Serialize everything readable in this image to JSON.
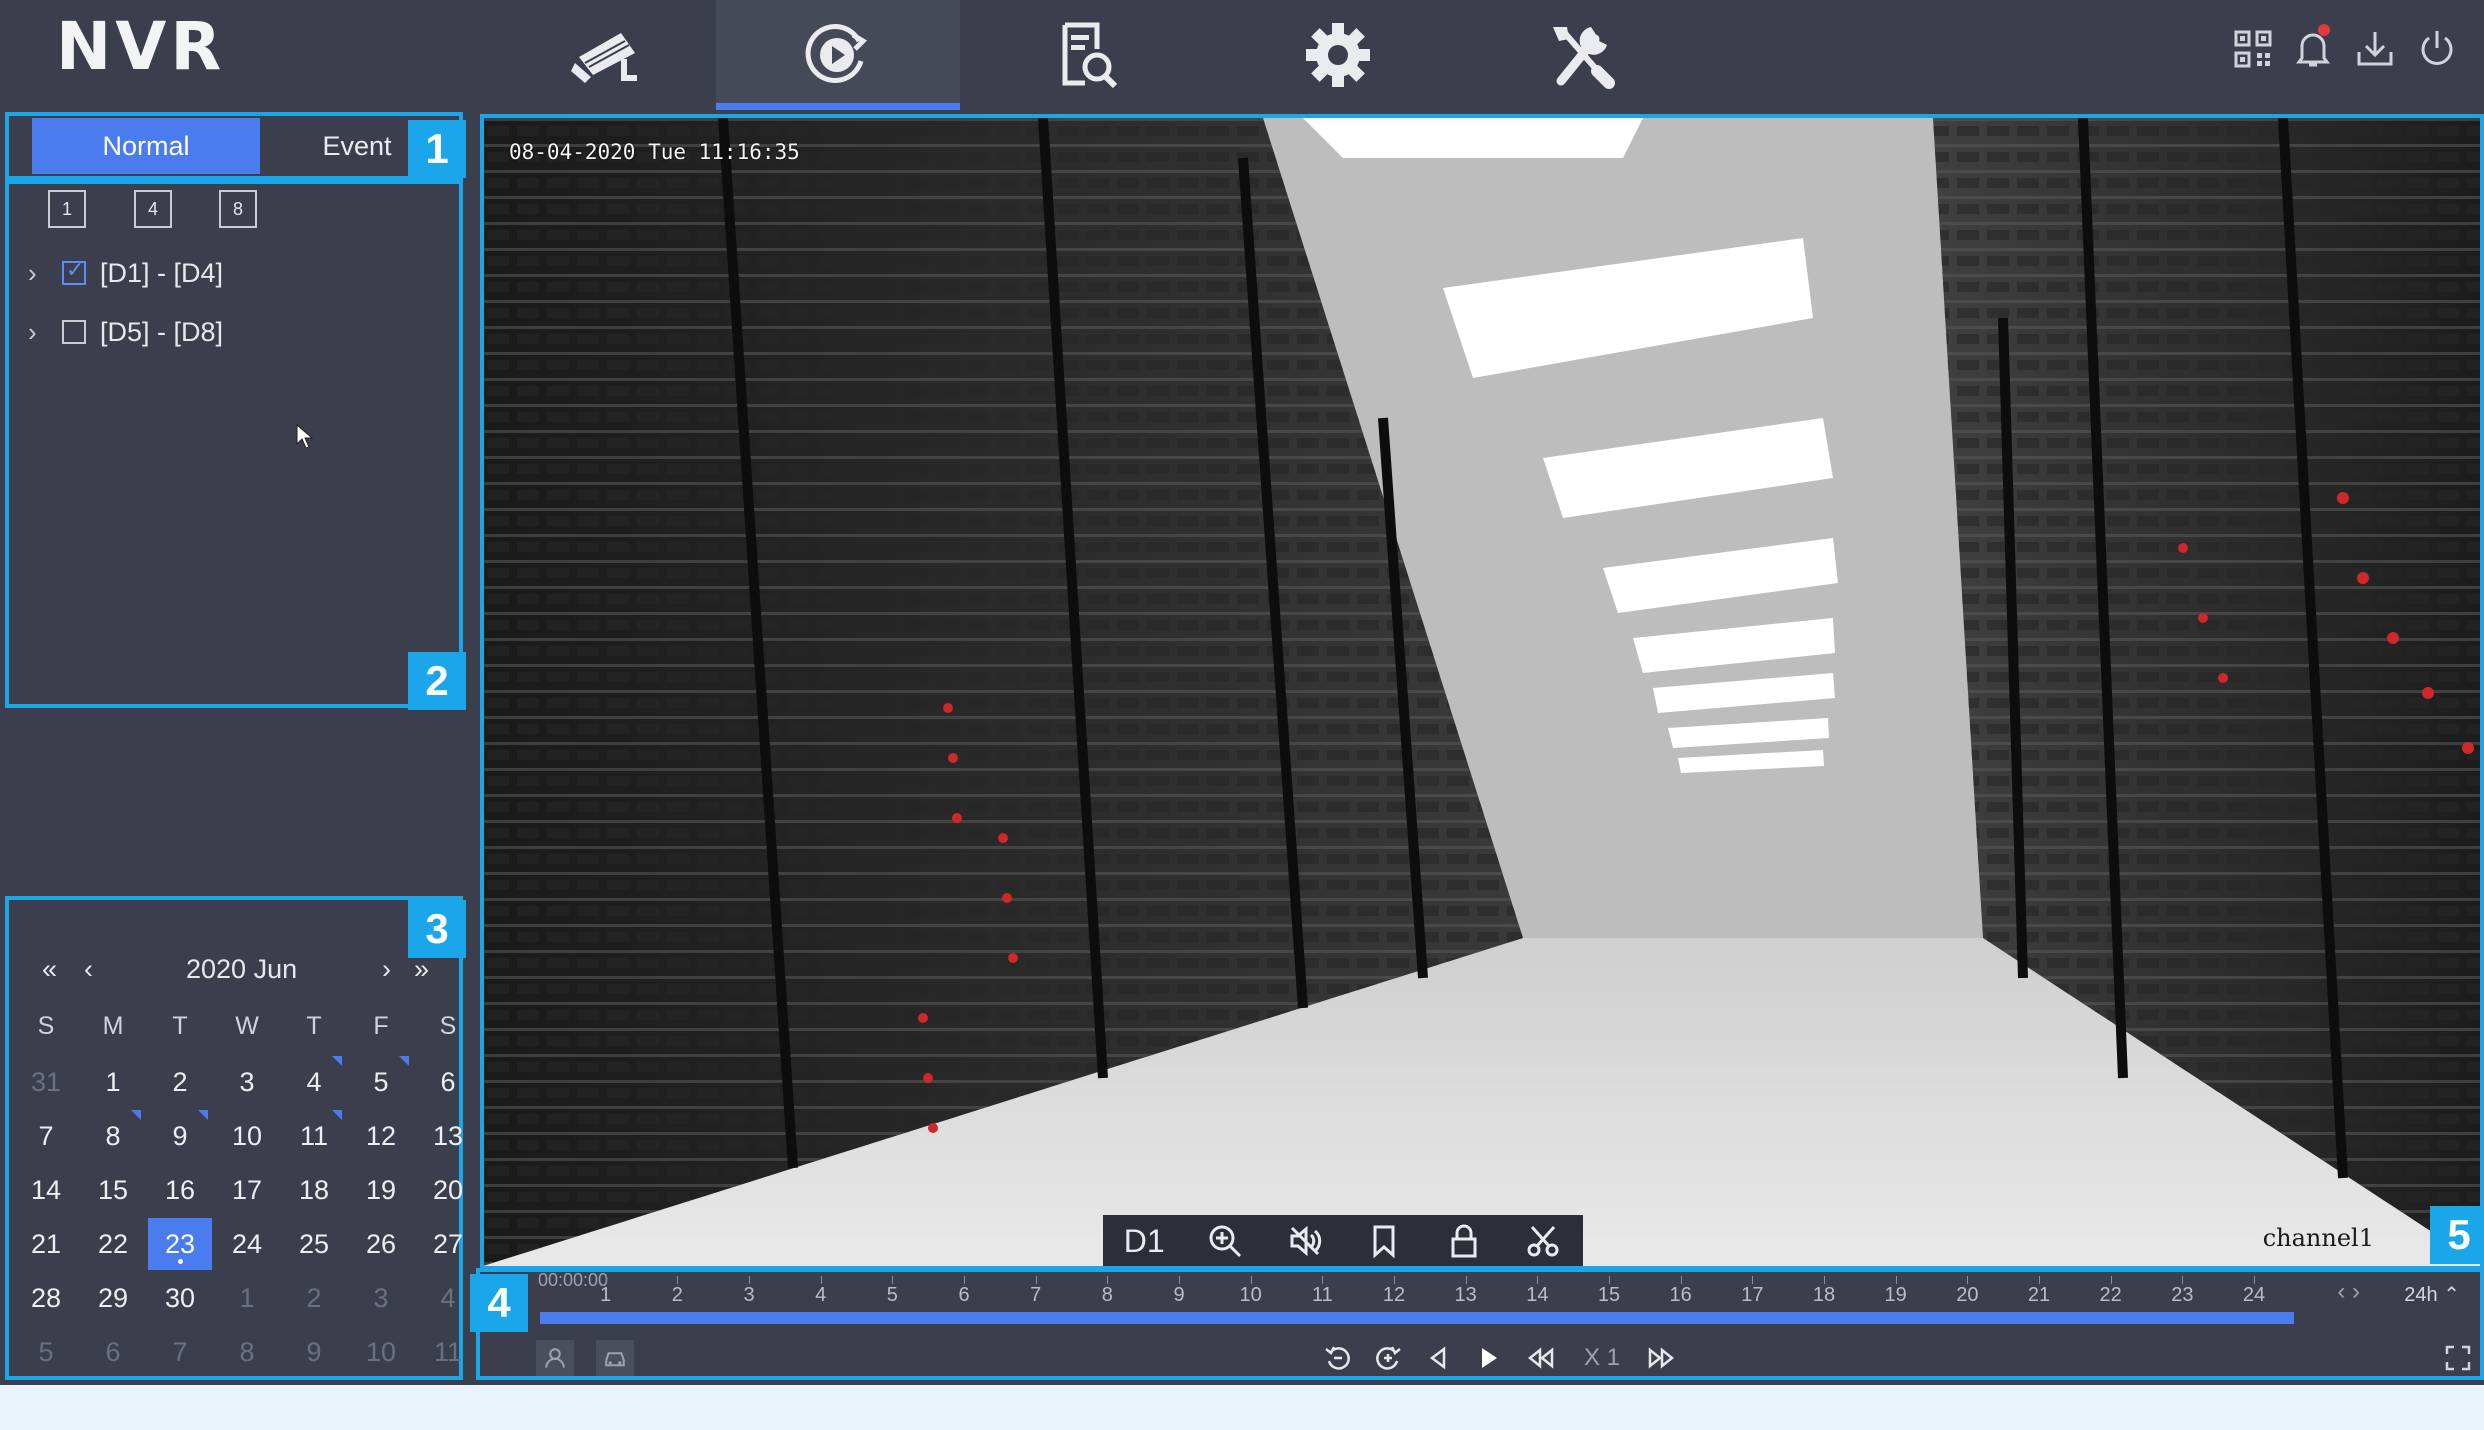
{
  "app": {
    "logo": "NVR"
  },
  "nav": {
    "items": [
      {
        "name": "live-view",
        "icon": "camera-icon"
      },
      {
        "name": "playback",
        "icon": "playback-icon",
        "active": true
      },
      {
        "name": "search",
        "icon": "file-search-icon"
      },
      {
        "name": "configuration",
        "icon": "gear-icon"
      },
      {
        "name": "maintenance",
        "icon": "tools-icon"
      }
    ],
    "right_icons": [
      "qr-code-icon",
      "bell-icon",
      "download-icon",
      "power-icon"
    ]
  },
  "left": {
    "tabs": [
      "Normal",
      "Event"
    ],
    "layouts": [
      "1",
      "4",
      "8"
    ],
    "tree": [
      {
        "label": "[D1] - [D4]",
        "checked": true
      },
      {
        "label": "[D5] - [D8]",
        "checked": false
      }
    ]
  },
  "badges": {
    "b1": "1",
    "b2": "2",
    "b3": "3",
    "b4": "4",
    "b5": "5"
  },
  "calendar": {
    "title": "2020 Jun",
    "first_prev": "«",
    "prev": "‹",
    "next": "›",
    "last_next": "»",
    "dow": [
      "S",
      "M",
      "T",
      "W",
      "T",
      "F",
      "S"
    ],
    "weeks": [
      [
        "31",
        "1",
        "2",
        "3",
        "4",
        "5",
        "6"
      ],
      [
        "7",
        "8",
        "9",
        "10",
        "11",
        "12",
        "13"
      ],
      [
        "14",
        "15",
        "16",
        "17",
        "18",
        "19",
        "20"
      ],
      [
        "21",
        "22",
        "23",
        "24",
        "25",
        "26",
        "27"
      ],
      [
        "28",
        "29",
        "30",
        "1",
        "2",
        "3",
        "4"
      ],
      [
        "5",
        "6",
        "7",
        "8",
        "9",
        "10",
        "11"
      ]
    ],
    "selected": "23",
    "recorded_days": [
      "4",
      "5",
      "8",
      "9",
      "11"
    ]
  },
  "video": {
    "osd_time": "08-04-2020 Tue 11:16:35",
    "channel_label": "channel1",
    "toolbar": {
      "channel": "D1"
    }
  },
  "timeline": {
    "start_label": "00:00:00",
    "hours": [
      "1",
      "2",
      "3",
      "4",
      "5",
      "6",
      "7",
      "8",
      "9",
      "10",
      "11",
      "12",
      "13",
      "14",
      "15",
      "16",
      "17",
      "18",
      "19",
      "20",
      "21",
      "22",
      "23",
      "24"
    ],
    "zoom": "24h",
    "speed": "X 1"
  },
  "colors": {
    "accent": "#4a7cf0",
    "highlight": "#1ba6ea",
    "background": "#3b3f4d"
  }
}
